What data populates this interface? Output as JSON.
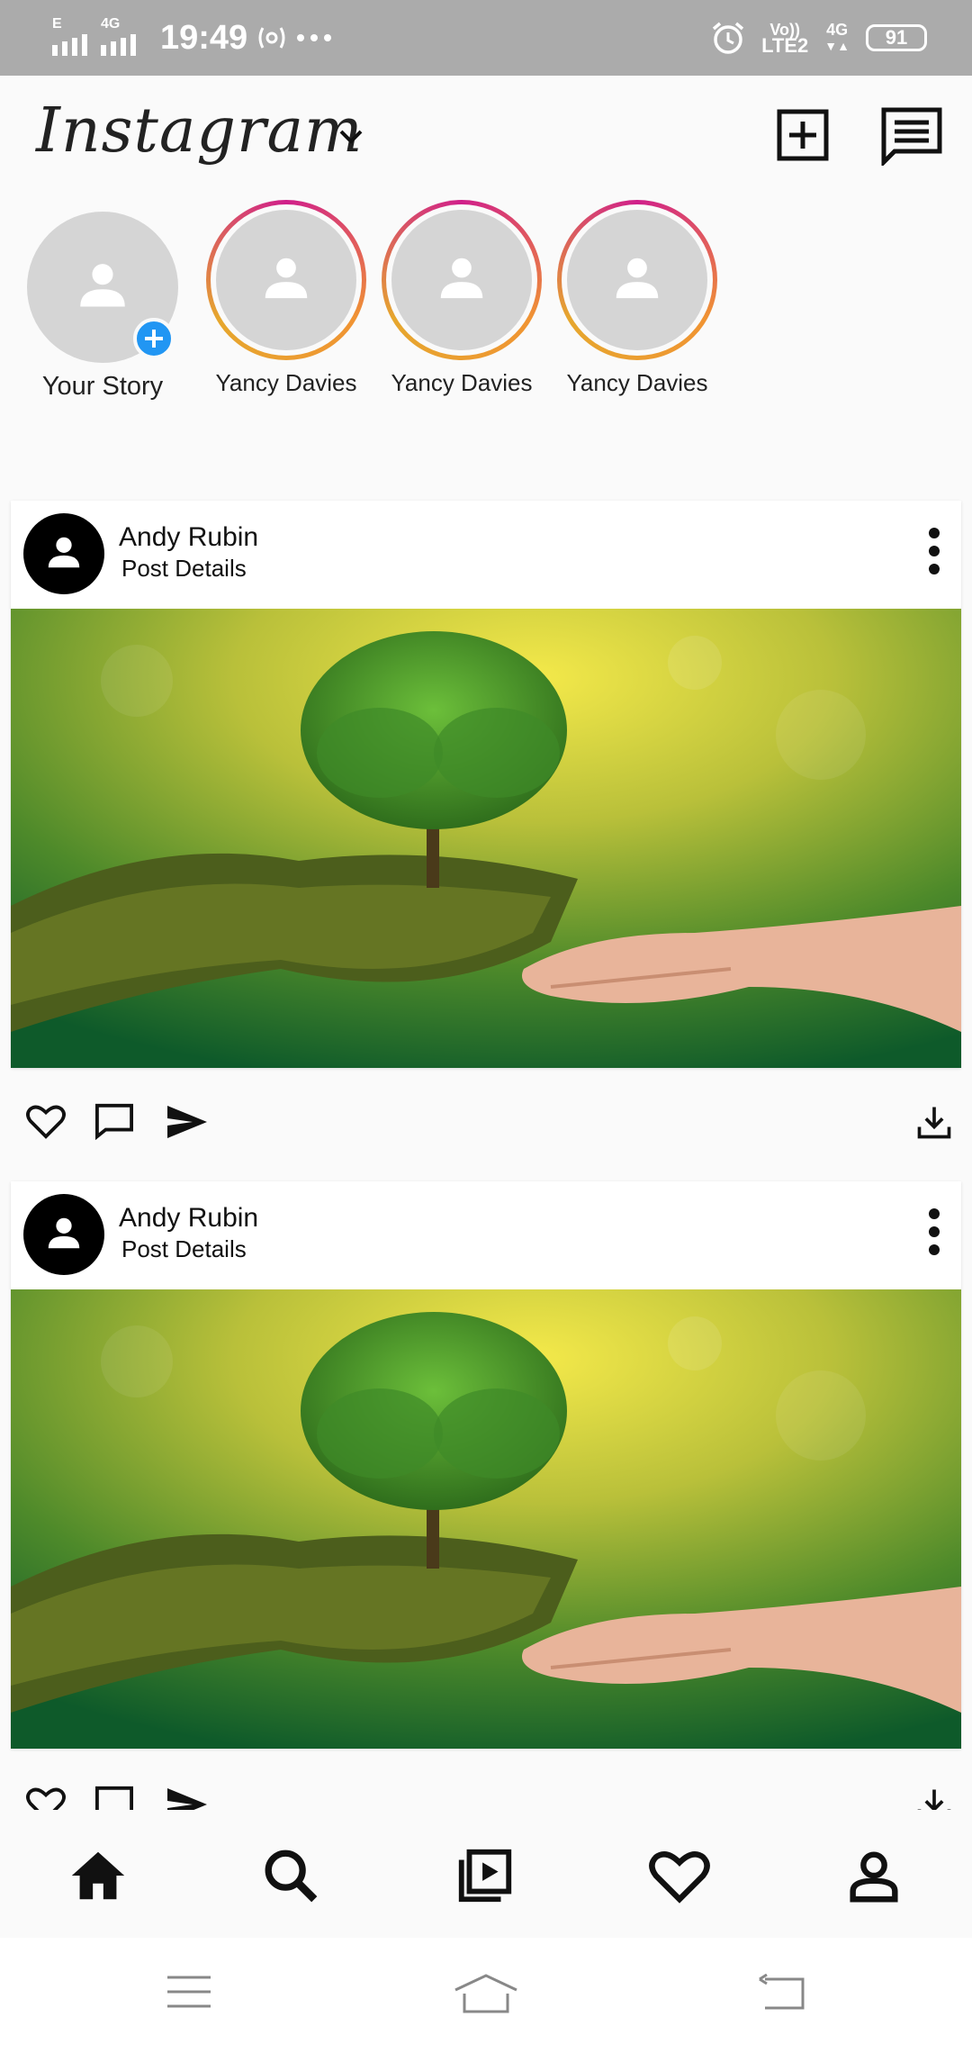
{
  "status_bar": {
    "time": "19:49",
    "net_left_1": "E",
    "net_left_2": "4G",
    "volte": "Vo))",
    "lte": "LTE2",
    "net_right": "4G",
    "battery": "91"
  },
  "header": {
    "logo": "Instagram"
  },
  "stories": [
    {
      "label": "Your Story",
      "own": true
    },
    {
      "label": "Yancy Davies"
    },
    {
      "label": "Yancy Davies"
    },
    {
      "label": "Yancy Davies"
    }
  ],
  "posts": [
    {
      "author": "Andy Rubin",
      "subtitle": "Post Details"
    },
    {
      "author": "Andy Rubin",
      "subtitle": "Post Details"
    }
  ],
  "colors": {
    "story_ring": [
      "#d01f8a",
      "#f09433"
    ],
    "add_badge": "#2196f3"
  },
  "icons": {
    "header": [
      "chevron-down-icon",
      "add-post-icon",
      "direct-message-icon"
    ],
    "post_actions": [
      "heart-icon",
      "comment-icon",
      "send-icon",
      "download-icon"
    ],
    "bottom_nav": [
      "home-icon",
      "search-icon",
      "reels-icon",
      "activity-heart-icon",
      "profile-icon"
    ],
    "system_nav": [
      "menu-icon",
      "home-outline-icon",
      "back-icon"
    ]
  }
}
